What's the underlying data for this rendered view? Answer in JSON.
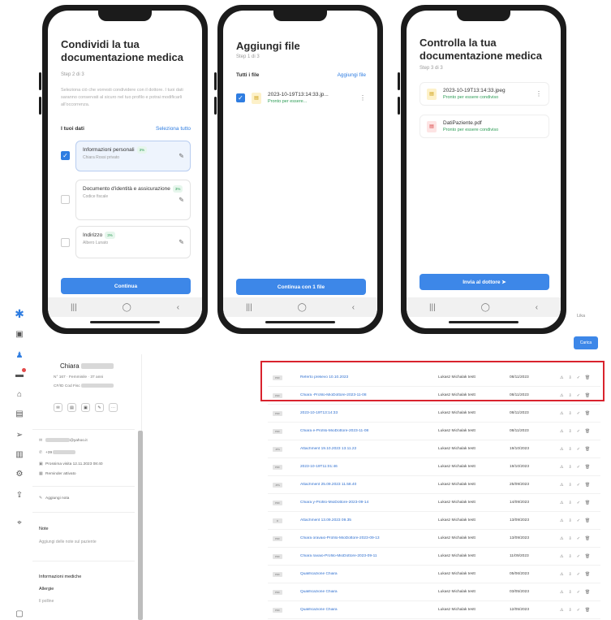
{
  "phone1": {
    "title": "Condividi la tua documentazione medica",
    "step": "Step 2 di 3",
    "description": "Seleziona ciò che vorresti condividere con il dottore. I tuoi dati saranno conservati al sicuro nel tuo profilo e potrai modificarli all'occorrenza.",
    "section_label": "I tuoi dati",
    "select_all": "Seleziona tutto",
    "cards": [
      {
        "title": "Informazioni personali",
        "tag": "3%",
        "subtitle": "Chiara Rossi privato",
        "checked": true
      },
      {
        "title": "Documento d'identità e assicurazione",
        "tag": "3%",
        "subtitle": "Codice fiscale",
        "checked": false
      },
      {
        "title": "Indirizzo",
        "tag": "3%",
        "subtitle": "Albero Lunato",
        "checked": false
      }
    ],
    "cta": "Continua",
    "nav": [
      "|||",
      "◯",
      "‹"
    ]
  },
  "phone2": {
    "title": "Aggiungi file",
    "step": "Step 1 di 3",
    "section_label": "Tutti i file",
    "add_link": "Aggiungi file",
    "file": {
      "name": "2023-10-19T13:14:33.jp...",
      "status": "Pronto per essere..."
    },
    "cta": "Continua con 1 file",
    "nav": [
      "|||",
      "◯",
      "‹"
    ]
  },
  "phone3": {
    "title": "Controlla la tua documentazione medica",
    "step": "Step 3 di 3",
    "files": [
      {
        "name": "2023-10-19T13:14:33.jpeg",
        "status": "Pronto per essere condiviso",
        "kind": "img"
      },
      {
        "name": "DatiPaziente.pdf",
        "status": "Pronto per essere condiviso",
        "kind": "pdf"
      }
    ],
    "cta": "Invia al dottore ➤",
    "nav": [
      "|||",
      "◯",
      "‹"
    ]
  },
  "rail": {
    "icons": [
      "asterisk-logo-icon",
      "calendar-icon",
      "patients-icon",
      "chat-icon",
      "analytics-icon",
      "documents-icon",
      "send-icon",
      "printer-icon",
      "settings-icon",
      "upload-icon",
      "more-icon",
      "footer-icon"
    ]
  },
  "profile": {
    "name": "Chiara",
    "line1": "N° 167 · Femminile · 37 anni",
    "line2": "CF/ID Cod Fisc",
    "email": "@yahoo.it",
    "phone": "+39",
    "next_visit": "Prossima visita 12.11.2023 08:40",
    "reminder": "Reminder attivato",
    "note_link": "Aggiungi nota",
    "notes_title": "Note",
    "notes_placeholder": "Aggiungi delle note sul paziente",
    "medical_title": "Informazioni mediche",
    "allergies_title": "Allergie",
    "allergies_value": "Il polline"
  },
  "header": {
    "lika": "Lika",
    "button": "Carica"
  },
  "table": {
    "rows": [
      {
        "type": "PDF",
        "name": "Referto prelievo 10.10.2023",
        "author": "Lukasz Michalak testt",
        "date": "08/11/2023"
      },
      {
        "type": "PDF",
        "name": "Chiara          -Profilo-MioDottore-2023-11-08",
        "author": "Lukasz Michalak testt",
        "date": "08/11/2023"
      },
      {
        "type": "PDF",
        "name": "2023-10-19T13:14:33",
        "author": "Lukasz Michalak testt",
        "date": "08/11/2023"
      },
      {
        "type": "PDF",
        "name": "Chiara          e-Profilo-MioDottore-2023-11-08",
        "author": "Lukasz Michalak testt",
        "date": "08/11/2023"
      },
      {
        "type": "JPG",
        "name": "Attachment 19.10.2023 13.11.22",
        "author": "Lukasz Michalak testt",
        "date": "19/10/2023"
      },
      {
        "type": "PDF",
        "name": "2023-10-19T11:01:46",
        "author": "Lukasz Michalak testt",
        "date": "19/10/2023"
      },
      {
        "type": "JPG",
        "name": "Attachment 25.09.2023 11.58.40",
        "author": "Lukasz Michalak testt",
        "date": "25/09/2023"
      },
      {
        "type": "PDF",
        "name": "Chiara          y-Profilo-MioDottore-2023-09-14",
        "author": "Lukasz Michalak testt",
        "date": "14/09/2023"
      },
      {
        "type": "D",
        "name": "Attachment 13.09.2023 09.35",
        "author": "Lukasz Michalak testt",
        "date": "13/09/2023"
      },
      {
        "type": "PDF",
        "name": "Chiara          oravaio-Profilo-MioDottore-2023-09-13",
        "author": "Lukasz Michalak testt",
        "date": "13/09/2023"
      },
      {
        "type": "PDF",
        "name": "Chiara          ravaio-Profilo-MioDottore-2023-09-11",
        "author": "Lukasz Michalak testt",
        "date": "11/09/2023"
      },
      {
        "type": "PDF",
        "name": "Qualificazione          Chiara",
        "author": "Lukasz Michalak testt",
        "date": "05/06/2023"
      },
      {
        "type": "PDF",
        "name": "Qualificazione          Chiara",
        "author": "Lukasz Michalak testt",
        "date": "03/05/2023"
      },
      {
        "type": "PDF",
        "name": "Qualificazione          Chiara",
        "author": "Lukasz Michalak testt",
        "date": "12/05/2023"
      },
      {
        "type": "PDF",
        "name": "Qualificazione          Chiara",
        "author": "Lukasz Michalak testt",
        "date": "05/05/2023"
      }
    ],
    "row_actions": [
      "⚠",
      "⇩",
      "✓",
      "🗑"
    ]
  }
}
